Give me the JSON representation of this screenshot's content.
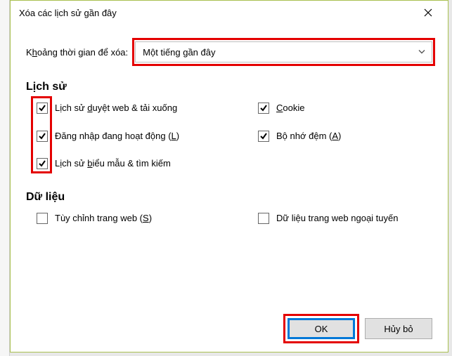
{
  "dialog": {
    "title": "Xóa các lịch sử gần đây",
    "range_label_pre": "K",
    "range_label_ul": "h",
    "range_label_post": "oảng thời gian để xóa:",
    "range_value": "Một tiếng gần đây"
  },
  "sections": {
    "history_title": "Lịch sử",
    "data_title": "Dữ liệu"
  },
  "history_items": [
    {
      "checked": true,
      "pre": "Lịch sử ",
      "ul": "d",
      "post": "uyệt web & tải xuống"
    },
    {
      "checked": true,
      "pre": "",
      "ul": "C",
      "post": "ookie"
    },
    {
      "checked": true,
      "pre": "Đăng nhập đang hoạt động (",
      "ul": "L",
      "post": ")"
    },
    {
      "checked": true,
      "pre": "Bộ nhớ đệm (",
      "ul": "A",
      "post": ")"
    },
    {
      "checked": true,
      "pre": "Lịch sử ",
      "ul": "b",
      "post": "iểu mẫu & tìm kiếm"
    }
  ],
  "data_items": [
    {
      "checked": false,
      "pre": "Tùy chỉnh trang web (",
      "ul": "S",
      "post": ")"
    },
    {
      "checked": false,
      "pre": "Dữ liệu trang web ngoại tuyến",
      "ul": "",
      "post": ""
    }
  ],
  "buttons": {
    "ok": "OK",
    "cancel": "Hủy bỏ"
  }
}
